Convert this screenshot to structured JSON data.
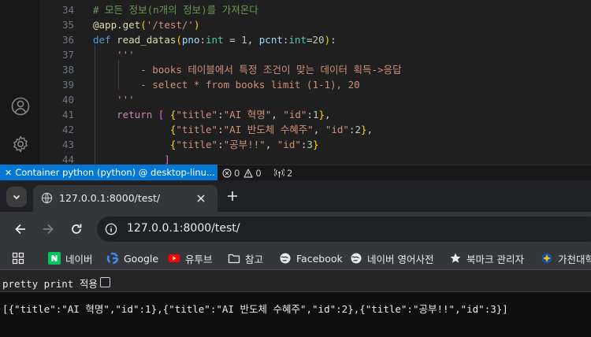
{
  "editor": {
    "line_numbers": [
      "34",
      "35",
      "36",
      "37",
      "38",
      "39",
      "40",
      "41",
      "42",
      "43",
      "44"
    ],
    "lines": [
      [
        {
          "c": "cm",
          "t": "# 모든 정보(n개의 정보)를 가져온다"
        }
      ],
      [
        {
          "c": "dec",
          "t": "@app.get"
        },
        {
          "c": "br",
          "t": "("
        },
        {
          "c": "st",
          "t": "'/test/'"
        },
        {
          "c": "br",
          "t": ")"
        }
      ],
      [
        {
          "c": "kw",
          "t": "def "
        },
        {
          "c": "fn",
          "t": "read_datas"
        },
        {
          "c": "br",
          "t": "("
        },
        {
          "c": "pm",
          "t": "pno"
        },
        {
          "c": "op",
          "t": ":"
        },
        {
          "c": "ty",
          "t": "int"
        },
        {
          "c": "op",
          "t": " = "
        },
        {
          "c": "nu",
          "t": "1"
        },
        {
          "c": "op",
          "t": ", "
        },
        {
          "c": "pm",
          "t": "pcnt"
        },
        {
          "c": "op",
          "t": ":"
        },
        {
          "c": "ty",
          "t": "int"
        },
        {
          "c": "op",
          "t": "="
        },
        {
          "c": "nu",
          "t": "20"
        },
        {
          "c": "br",
          "t": ")"
        },
        {
          "c": "op",
          "t": ":"
        }
      ],
      [
        {
          "c": "st",
          "t": "    '''"
        }
      ],
      [
        {
          "c": "st",
          "t": "        - books 테이블에서 특정 조건이 맞는 데이터 획득->응답"
        }
      ],
      [
        {
          "c": "st",
          "t": "        - select * from books limit (1-1), 20"
        }
      ],
      [
        {
          "c": "st",
          "t": "    '''"
        }
      ],
      [
        {
          "c": "ctl",
          "t": "    return "
        },
        {
          "c": "br2",
          "t": "[ "
        },
        {
          "c": "br",
          "t": "{"
        },
        {
          "c": "st",
          "t": "\"title\""
        },
        {
          "c": "op",
          "t": ":"
        },
        {
          "c": "st",
          "t": "\"AI 혁명\""
        },
        {
          "c": "op",
          "t": ", "
        },
        {
          "c": "st",
          "t": "\"id\""
        },
        {
          "c": "op",
          "t": ":"
        },
        {
          "c": "nu",
          "t": "1"
        },
        {
          "c": "br",
          "t": "}"
        },
        {
          "c": "op",
          "t": ","
        }
      ],
      [
        {
          "c": "op",
          "t": "             "
        },
        {
          "c": "br",
          "t": "{"
        },
        {
          "c": "st",
          "t": "\"title\""
        },
        {
          "c": "op",
          "t": ":"
        },
        {
          "c": "st",
          "t": "\"AI 반도체 수혜주\""
        },
        {
          "c": "op",
          "t": ", "
        },
        {
          "c": "st",
          "t": "\"id\""
        },
        {
          "c": "op",
          "t": ":"
        },
        {
          "c": "nu",
          "t": "2"
        },
        {
          "c": "br",
          "t": "}"
        },
        {
          "c": "op",
          "t": ","
        }
      ],
      [
        {
          "c": "op",
          "t": "             "
        },
        {
          "c": "br",
          "t": "{"
        },
        {
          "c": "st",
          "t": "\"title\""
        },
        {
          "c": "op",
          "t": ":"
        },
        {
          "c": "st",
          "t": "\"공부!!\""
        },
        {
          "c": "op",
          "t": ", "
        },
        {
          "c": "st",
          "t": "\"id\""
        },
        {
          "c": "op",
          "t": ":"
        },
        {
          "c": "nu",
          "t": "3"
        },
        {
          "c": "br",
          "t": "}"
        }
      ],
      [
        {
          "c": "br2",
          "t": "            ]"
        }
      ]
    ]
  },
  "statusbar": {
    "remote": "Container python (python) @ desktop-linu...",
    "errors": "0",
    "warnings": "0",
    "ports": "2"
  },
  "browser": {
    "tab_title": "127.0.0.1:8000/test/",
    "url": "127.0.0.1:8000/test/",
    "bookmarks": [
      "네이버",
      "Google",
      "유투브",
      "참고",
      "Facebook",
      "네이버 영어사전",
      "북마크 관리자",
      "가천대학"
    ],
    "pretty_print_label": "pretty print 적용",
    "json_output": "[{\"title\":\"AI 혁명\",\"id\":1},{\"title\":\"AI 반도체 수혜주\",\"id\":2},{\"title\":\"공부!!\",\"id\":3}]"
  },
  "colors": {
    "remote_bg": "#0078d4",
    "editor_bg": "#1f1f1f",
    "chrome_toolbar": "#35363a"
  }
}
